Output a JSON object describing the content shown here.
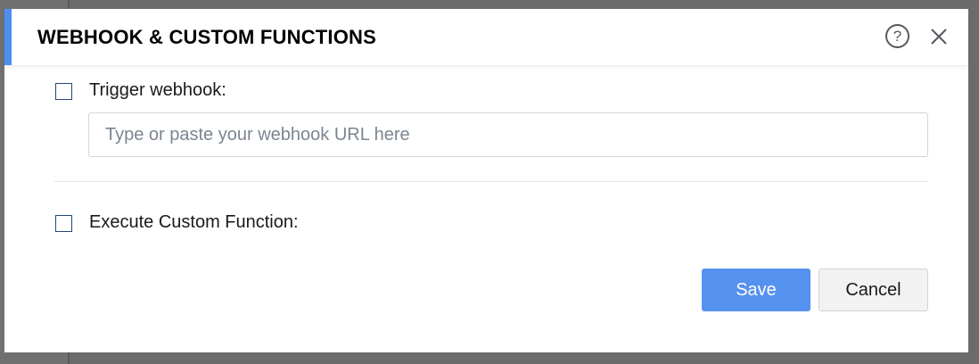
{
  "dialog": {
    "title": "WEBHOOK & CUSTOM FUNCTIONS",
    "help_icon": "question-circle-icon",
    "help_glyph": "?",
    "close_icon": "close-icon"
  },
  "options": {
    "trigger_webhook": {
      "label": "Trigger webhook:",
      "checked": false,
      "input_value": "",
      "input_placeholder": "Type or paste your webhook URL here"
    },
    "execute_custom_function": {
      "label": "Execute Custom Function:",
      "checked": false
    }
  },
  "footer": {
    "save_label": "Save",
    "cancel_label": "Cancel"
  },
  "colors": {
    "accent": "#4f8ff0",
    "primary_button": "#5591ee",
    "checkbox_border": "#29476e"
  }
}
